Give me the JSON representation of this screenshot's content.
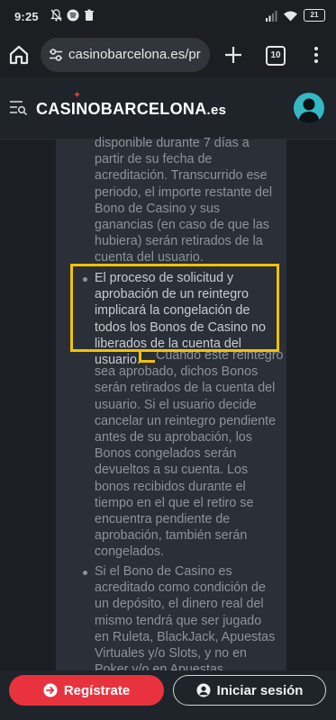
{
  "status_bar": {
    "time": "9:25",
    "battery": "21",
    "left_icons": [
      "muted-bell-icon",
      "spotify-icon",
      "trash-icon"
    ],
    "right_icons": [
      "signal-icon",
      "wifi-icon",
      "battery-icon"
    ]
  },
  "browser": {
    "url": "casinobarcelona.es/pr",
    "tab_count": "10"
  },
  "site": {
    "logo_main": "CASINOBARCELONA",
    "logo_suffix": ".es"
  },
  "content": {
    "para1": "disponible durante 7 días a\npartir de su fecha de\nacreditación. Transcurrido ese\nperiodo, el importe restante del\nBono de Casino y sus\nganancias (en caso de que las\nhubiera) serán retirados de la\ncuenta del usuario.",
    "para2_highlight": "El proceso de solicitud y\naprobación de un reintegro\nimplicará la congelación de\ntodos los Bonos de Casino no\nliberados de la cuenta del\nusuario.",
    "para2_rest": "Cuando este reintegro\nsea aprobado, dichos Bonos\nserán retirados de la cuenta del\nusuario. Si el usuario decide\ncancelar un reintegro pendiente\nantes de su aprobación, los\nBonos congelados serán\ndevueltos a su cuenta. Los\nbonos recibidos durante el\ntiempo en el que el retiro se\nencuentra pendiente de\naprobación, también serán\ncongelados.",
    "para3": "Si el Bono de Casino es\nacreditado como condición de\nun depósito, el dinero real del\nmismo tendrá que ser jugado\nen Ruleta, BlackJack, Apuestas\nVirtuales y/o Slots, y no en\nPoker y/o en Apuestas"
  },
  "bottom_bar": {
    "register_label": "Regístrate",
    "login_label": "Iniciar sesión"
  },
  "colors": {
    "accent_red": "#e8333f",
    "highlight_yellow": "#f2c200",
    "avatar_teal": "#34b9c4"
  }
}
